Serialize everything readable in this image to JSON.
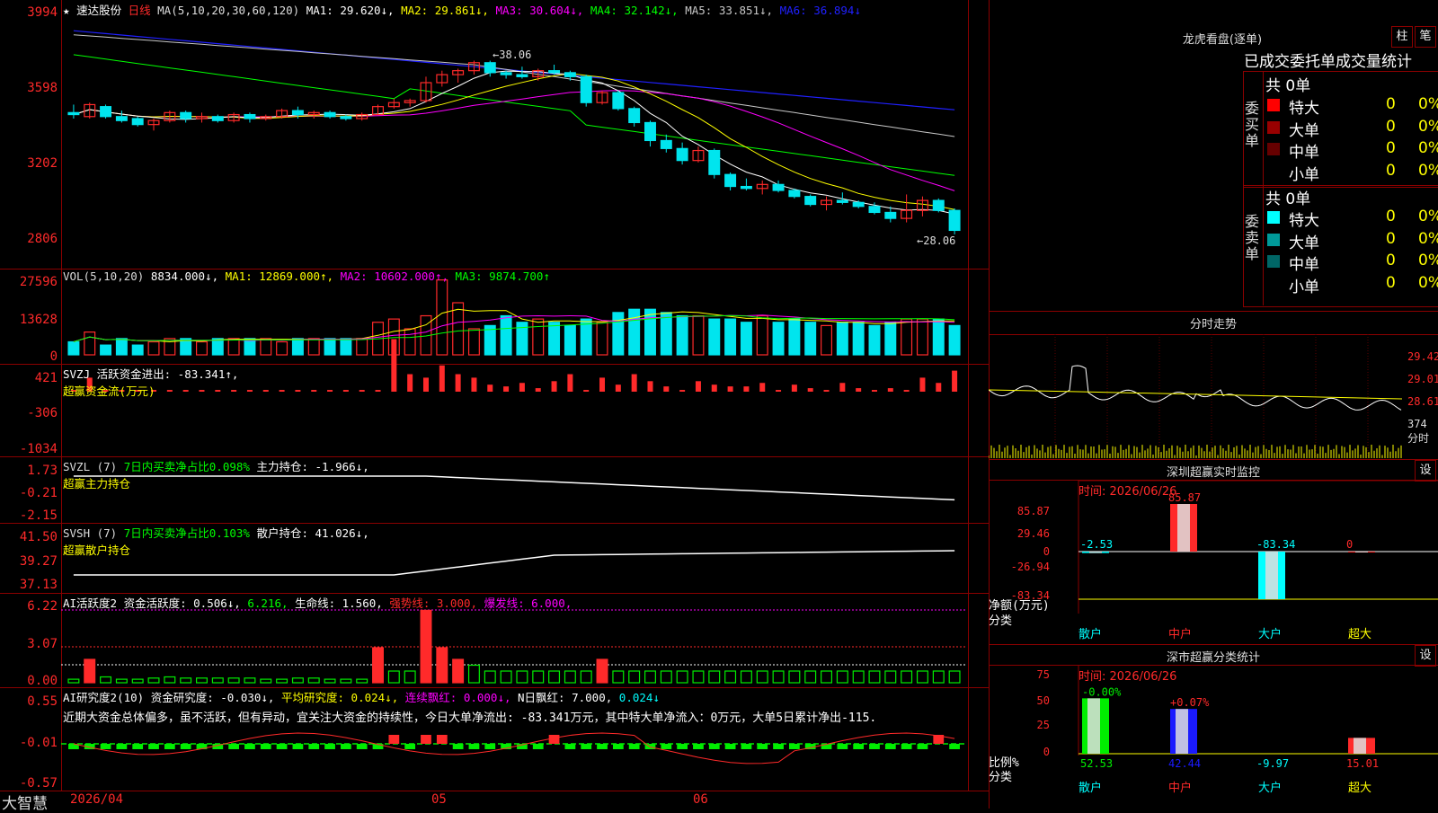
{
  "colors": {
    "up": "#ff2a2a",
    "down": "#00e5ee",
    "grid": "#8a0000",
    "ma1": "#ffffff",
    "ma2": "#ffff00",
    "ma3": "#ff00ff",
    "ma4": "#00ff00",
    "ma5": "#c8c8c8",
    "ma6": "#2020ff"
  },
  "header": {
    "stock_name": "速达股份",
    "period": "日线",
    "ma_prefix": "MA(5,10,20,30,60,120)",
    "ma1": "MA1: 29.620↓,",
    "ma2": "MA2: 29.861↓,",
    "ma3": "MA3: 30.604↓,",
    "ma4": "MA4: 32.142↓,",
    "ma5": "MA5: 33.851↓,",
    "ma6": "MA6: 36.894↓"
  },
  "price_axis": [
    "3994",
    "3598",
    "3202",
    "2806"
  ],
  "price_annotations": {
    "high": "←38.06",
    "low": "←28.06"
  },
  "vol": {
    "header": {
      "prefix": "VOL(5,10,20)",
      "val": "8834.000↓,",
      "ma1": "MA1: 12869.000↑,",
      "ma2": "MA2: 10602.000↑,",
      "ma3": "MA3: 9874.700↑"
    },
    "axis": [
      "27596",
      "13628",
      "0"
    ]
  },
  "svzj": {
    "line1": "SVZJ  活跃资金进出: -83.341↑,",
    "line2": "超赢资金流(万元)",
    "axis": [
      "421",
      "-306",
      "-1034"
    ]
  },
  "svzl": {
    "prefix": "SVZL (7)",
    "desc": "7日内买卖净占比0.098%",
    "val": "主力持仓: -1.966↓,",
    "line2": "超赢主力持仓",
    "axis": [
      "1.73",
      "-0.21",
      "-2.15"
    ]
  },
  "svsh": {
    "prefix": "SVSH (7)",
    "desc": "7日内买卖净占比0.103%",
    "val": "散户持仓: 41.026↓,",
    "line2": "超赢散户持仓",
    "axis": [
      "41.50",
      "39.27",
      "37.13"
    ]
  },
  "ai1": {
    "a": "AI活跃度2 资金活跃度: 0.506↓,",
    "b": "6.216,",
    "c": "生命线: 1.560,",
    "d": "强势线: 3.000,",
    "e": "爆发线: 6.000,",
    "axis": [
      "6.22",
      "3.07",
      "0.00"
    ]
  },
  "ai2": {
    "a": "AI研究度2(10) 资金研究度: -0.030↓,",
    "b": "平均研究度: 0.024↓,",
    "c": "连续飘红: 0.000↓,",
    "d": "N日飘红: 7.000,",
    "e": "0.024↓",
    "comment": "近期大资金总体偏多，虽不活跃，但有异动，宜关注大资金的持续性，今日大单净流出: -83.341万元，其中特大单净流入：0万元，大单5日累计净出-115.",
    "axis": [
      "0.55",
      "-0.01",
      "-0.57"
    ]
  },
  "date_axis": {
    "start": "2026/04",
    "m1": "05",
    "m2": "06"
  },
  "brand": "大智慧",
  "lhb": {
    "title": "龙虎看盘(逐单)",
    "btn1": "柱",
    "btn2": "笔",
    "subtitle": "已成交委托单成交量统计",
    "buy": {
      "side": "委买单",
      "total": "共 0单",
      "rows": [
        {
          "label": "特大",
          "v": "0",
          "p": "0%",
          "c": "#ff0000"
        },
        {
          "label": "大单",
          "v": "0",
          "p": "0%",
          "c": "#990000"
        },
        {
          "label": "中单",
          "v": "0",
          "p": "0%",
          "c": "#660000"
        },
        {
          "label": "小单",
          "v": "0",
          "p": "0%",
          "c": ""
        }
      ]
    },
    "sell": {
      "side": "委卖单",
      "total": "共 0单",
      "rows": [
        {
          "label": "特大",
          "v": "0",
          "p": "0%",
          "c": "#00ffff"
        },
        {
          "label": "大单",
          "v": "0",
          "p": "0%",
          "c": "#009999"
        },
        {
          "label": "中单",
          "v": "0",
          "p": "0%",
          "c": "#006666"
        },
        {
          "label": "小单",
          "v": "0",
          "p": "0%",
          "c": ""
        }
      ]
    }
  },
  "intraday": {
    "title": "分时走势",
    "axis": [
      "29.42",
      "29.01",
      "28.61"
    ],
    "vol_axis": [
      "374",
      "分时"
    ]
  },
  "monitor": {
    "title": "深圳超赢实时监控",
    "btn": "设",
    "time": "时间: 2026/06/26",
    "axis": [
      "85.87",
      "29.46",
      "0",
      "-26.94",
      "-83.34"
    ],
    "ylabel": "净额(万元)",
    "xlabel": "分类",
    "categories": [
      "散户",
      "中户",
      "大户",
      "超大"
    ],
    "values": [
      "-2.53",
      "85.87",
      "-83.34",
      "0"
    ]
  },
  "classify": {
    "title": "深市超赢分类统计",
    "btn": "设",
    "time": "时间: 2026/06/26",
    "axis": [
      "75",
      "50",
      "25",
      "0"
    ],
    "ylabel": "比例%",
    "xlabel": "分类",
    "categories": [
      "散户",
      "中户",
      "大户",
      "超大"
    ],
    "values": [
      "52.53",
      "42.44",
      "-9.97",
      "15.01"
    ],
    "changes": [
      "-0.00%",
      "+0.07%"
    ]
  },
  "chart_data": {
    "type": "candlestick",
    "price_scale_note": "price axis ticks 3994, 3598, 3202, 2806",
    "ohlc": [
      [
        35.5,
        35.9,
        35.2,
        35.4
      ],
      [
        35.3,
        36.0,
        35.2,
        35.9
      ],
      [
        35.8,
        35.9,
        35.2,
        35.3
      ],
      [
        35.3,
        35.6,
        35.0,
        35.1
      ],
      [
        35.2,
        35.3,
        34.8,
        34.9
      ],
      [
        34.9,
        35.2,
        34.6,
        35.1
      ],
      [
        35.1,
        35.6,
        35.0,
        35.5
      ],
      [
        35.5,
        35.6,
        35.0,
        35.2
      ],
      [
        35.2,
        35.5,
        35.0,
        35.3
      ],
      [
        35.3,
        35.4,
        35.0,
        35.1
      ],
      [
        35.1,
        35.5,
        35.0,
        35.4
      ],
      [
        35.4,
        35.5,
        35.0,
        35.2
      ],
      [
        35.2,
        35.4,
        35.1,
        35.3
      ],
      [
        35.3,
        35.7,
        35.2,
        35.6
      ],
      [
        35.6,
        35.8,
        35.2,
        35.4
      ],
      [
        35.4,
        35.6,
        35.2,
        35.5
      ],
      [
        35.5,
        35.6,
        35.2,
        35.3
      ],
      [
        35.3,
        35.4,
        35.1,
        35.2
      ],
      [
        35.2,
        35.5,
        35.1,
        35.4
      ],
      [
        35.4,
        35.9,
        35.4,
        35.8
      ],
      [
        35.8,
        36.2,
        35.7,
        36.0
      ],
      [
        36.0,
        36.2,
        35.8,
        36.1
      ],
      [
        36.1,
        37.3,
        36.0,
        37.0
      ],
      [
        37.0,
        37.6,
        36.8,
        37.4
      ],
      [
        37.4,
        37.7,
        37.0,
        37.6
      ],
      [
        37.6,
        38.1,
        37.4,
        38.0
      ],
      [
        38.0,
        38.1,
        37.3,
        37.5
      ],
      [
        37.5,
        37.6,
        37.2,
        37.4
      ],
      [
        37.4,
        37.8,
        37.2,
        37.3
      ],
      [
        37.3,
        37.7,
        37.1,
        37.6
      ],
      [
        37.6,
        37.9,
        37.4,
        37.5
      ],
      [
        37.5,
        37.6,
        37.1,
        37.3
      ],
      [
        37.3,
        37.4,
        35.8,
        36.0
      ],
      [
        36.0,
        36.6,
        35.9,
        36.5
      ],
      [
        36.5,
        36.6,
        35.6,
        35.7
      ],
      [
        35.7,
        35.8,
        34.8,
        35.0
      ],
      [
        35.0,
        35.1,
        33.8,
        34.1
      ],
      [
        34.1,
        34.4,
        33.5,
        33.7
      ],
      [
        33.7,
        34.0,
        32.9,
        33.1
      ],
      [
        33.1,
        33.8,
        33.0,
        33.6
      ],
      [
        33.6,
        33.7,
        32.2,
        32.4
      ],
      [
        32.4,
        32.5,
        31.6,
        31.8
      ],
      [
        31.8,
        32.2,
        31.6,
        31.7
      ],
      [
        31.7,
        32.1,
        31.4,
        31.9
      ],
      [
        31.9,
        32.1,
        31.5,
        31.6
      ],
      [
        31.6,
        31.7,
        31.2,
        31.3
      ],
      [
        31.3,
        31.4,
        30.8,
        30.9
      ],
      [
        30.9,
        31.3,
        30.6,
        31.1
      ],
      [
        31.1,
        31.5,
        30.9,
        31.0
      ],
      [
        31.0,
        31.1,
        30.7,
        30.8
      ],
      [
        30.8,
        31.0,
        30.4,
        30.5
      ],
      [
        30.5,
        30.8,
        30.0,
        30.2
      ],
      [
        30.2,
        31.4,
        30.0,
        30.6
      ],
      [
        30.6,
        31.3,
        30.3,
        31.1
      ],
      [
        31.1,
        31.2,
        30.5,
        30.6
      ],
      [
        30.6,
        30.7,
        29.4,
        29.6
      ]
    ],
    "volume": [
      4.0,
      7.0,
      3.0,
      5.0,
      3.0,
      4.0,
      5.0,
      5.0,
      4.0,
      5.0,
      5.0,
      5.0,
      5.0,
      4.0,
      5.0,
      5.0,
      5.0,
      5.0,
      5.0,
      10.0,
      11.0,
      8.0,
      12.0,
      23.0,
      16.0,
      8.0,
      9.0,
      12.0,
      10.0,
      11.0,
      10.0,
      9.0,
      11.0,
      10.0,
      13.0,
      14.0,
      14.0,
      13.0,
      12.0,
      12.0,
      11.0,
      11.0,
      10.0,
      12.0,
      10.0,
      11.0,
      10.0,
      9.0,
      10.0,
      10.0,
      9.0,
      10.0,
      11.0,
      11.0,
      11.0,
      9.0
    ],
    "fund_flow": [
      -1,
      -2,
      -1,
      -1,
      -1,
      -1,
      -1,
      -1,
      -1,
      -1,
      -1,
      -1,
      -1,
      -1,
      -1,
      -1,
      -1,
      -1,
      -1,
      -1,
      -30,
      -10,
      -8,
      -15,
      -10,
      -8,
      -12,
      -3,
      -5,
      -2,
      -6,
      -10,
      -1,
      -8,
      -4,
      -10,
      -6,
      -3,
      -1,
      -6,
      -4,
      -3,
      -2,
      -5,
      -1,
      -4,
      -2,
      -1,
      -5,
      -2,
      -1,
      -2,
      -1,
      -8,
      -5,
      -4
    ],
    "macd_like": [
      0.3,
      2.0,
      0.5,
      0.3,
      0.3,
      0.4,
      0.5,
      0.4,
      0.4,
      0.4,
      0.4,
      0.4,
      0.3,
      0.3,
      0.4,
      0.4,
      0.3,
      0.3,
      0.3,
      3.0,
      1.0,
      1.0,
      6.2,
      3.0,
      2.0,
      1.5,
      1.0,
      1.0,
      1.0,
      1.0,
      1.0,
      1.0,
      1.0,
      2.0,
      1.0,
      1.0,
      1.0,
      1.0,
      1.0,
      1.0,
      1.0,
      1.0,
      1.0,
      1.0,
      1.0,
      1.0,
      1.0,
      1.0,
      1.0,
      1.0,
      1.0,
      1.0,
      1.0,
      1.0,
      1.0,
      1.0
    ],
    "price_axis": [
      39.94,
      35.98,
      32.02,
      28.06
    ]
  }
}
